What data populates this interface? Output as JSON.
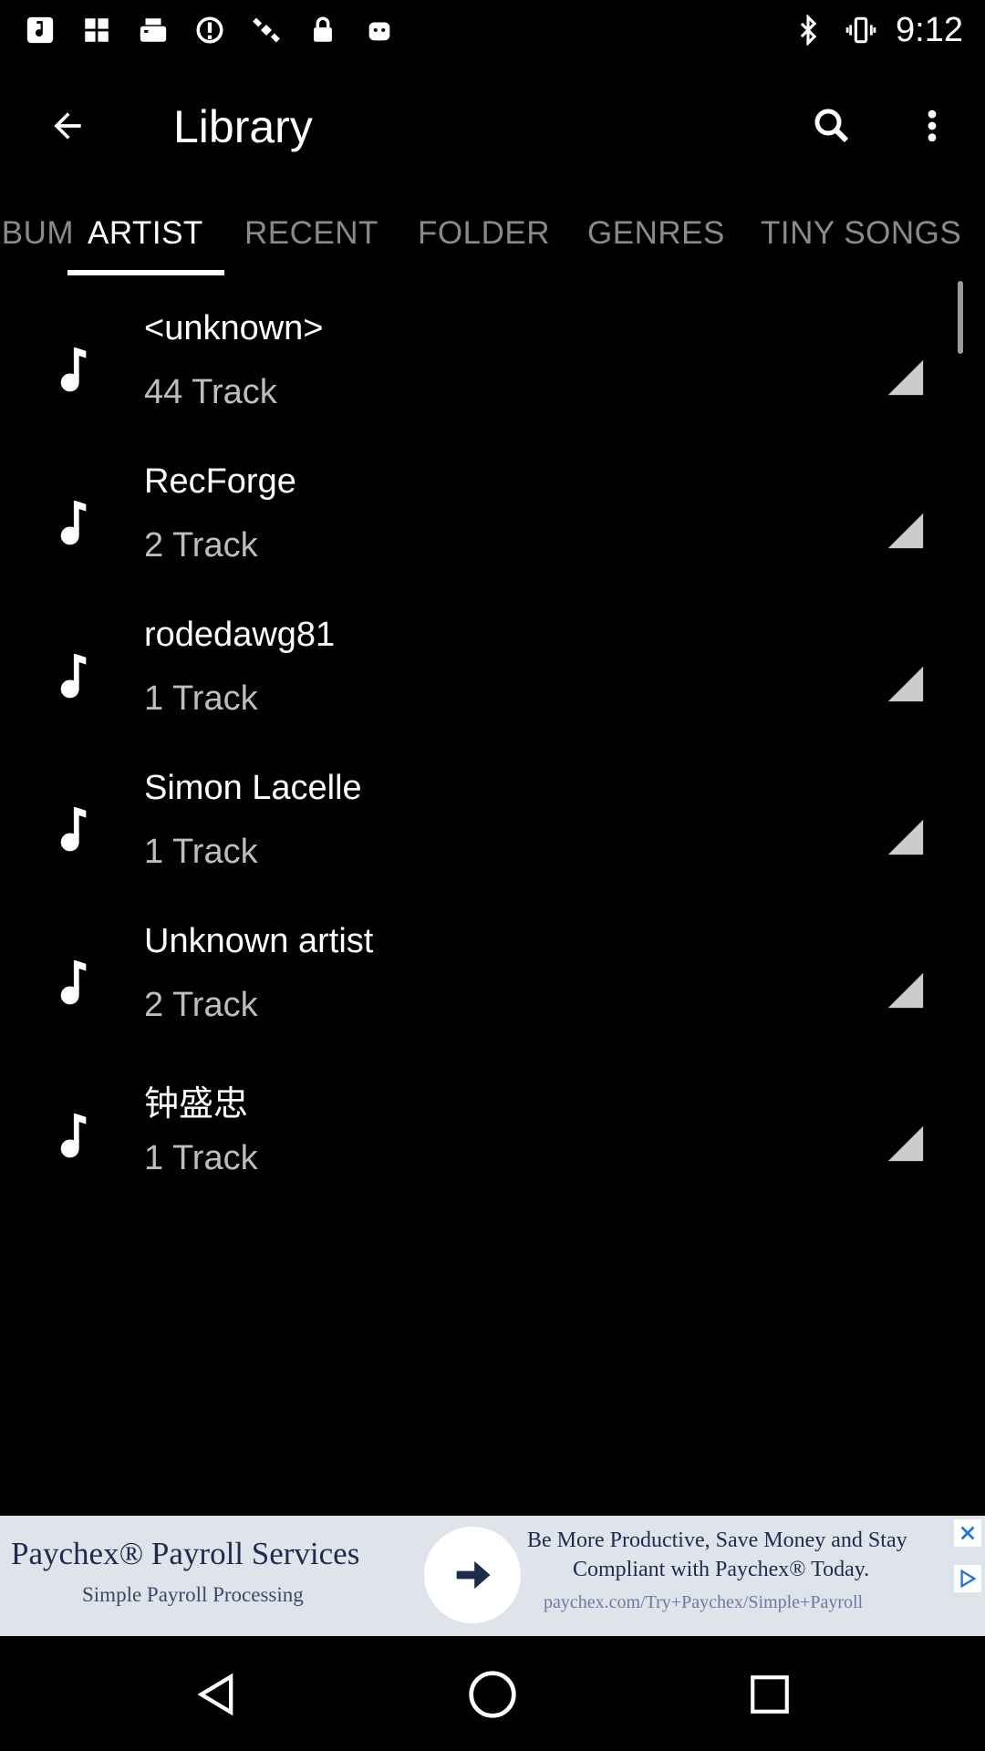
{
  "status_bar": {
    "time": "9:12",
    "left_icons": [
      "music-note-icon",
      "grid-icon",
      "fax-icon",
      "no-sim-icon",
      "satellite-icon",
      "lock-icon",
      "android-icon"
    ],
    "right_icons": [
      "bluetooth-icon",
      "vibrate-icon"
    ]
  },
  "app_bar": {
    "title": "Library",
    "back_icon": "back-arrow-icon",
    "search_icon": "search-icon",
    "menu_icon": "more-vert-icon"
  },
  "tabs": {
    "items": [
      {
        "label": "ALBUM"
      },
      {
        "label": "ARTIST"
      },
      {
        "label": "RECENT"
      },
      {
        "label": "FOLDER"
      },
      {
        "label": "GENRES"
      },
      {
        "label": "TINY SONGS"
      }
    ],
    "active_index": 1
  },
  "artists": [
    {
      "name": "<unknown>",
      "tracks": "44 Track"
    },
    {
      "name": "RecForge",
      "tracks": "2 Track"
    },
    {
      "name": "rodedawg81",
      "tracks": "1 Track"
    },
    {
      "name": "Simon Lacelle",
      "tracks": "1 Track"
    },
    {
      "name": "Unknown artist",
      "tracks": "2 Track"
    },
    {
      "name": "钟盛忠",
      "tracks": "1 Track"
    }
  ],
  "ad": {
    "left_title": "Paychex® Payroll Services",
    "left_subtitle": "Simple Payroll Processing",
    "right_line1": "Be More Productive, Save Money and Stay",
    "right_line2": "Compliant with Paychex® Today.",
    "right_url": "paychex.com/Try+Paychex/Simple+Payroll"
  },
  "colors": {
    "background": "#000000",
    "text_primary": "#ffffff",
    "text_secondary": "#bdbdbd",
    "tab_inactive": "#8a8a8a",
    "ad_background": "#dfe3ea",
    "ad_text": "#1e2a4f",
    "ad_accent": "#1a73e8"
  }
}
